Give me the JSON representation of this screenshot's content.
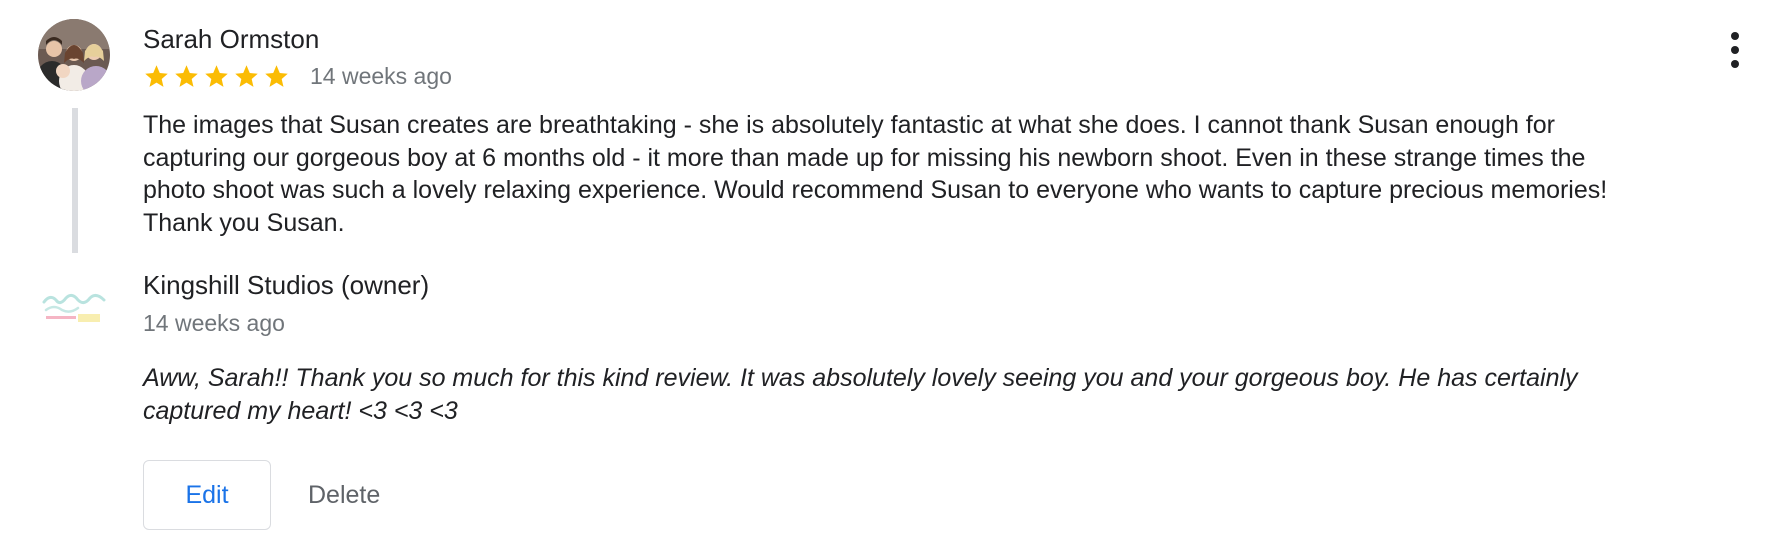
{
  "review": {
    "reviewer_name": "Sarah Ormston",
    "rating": 5,
    "max_rating": 5,
    "date": "14 weeks ago",
    "text": "The images that Susan creates are breathtaking - she is absolutely fantastic at what she does. I cannot thank Susan enough for capturing our gorgeous boy at 6 months old - it more than made up for missing his newborn shoot. Even in these strange times the photo shoot was such a lovely relaxing experience. Would recommend Susan to everyone who wants to capture precious memories! Thank you Susan.",
    "more_icon": "more-vert-icon"
  },
  "reply": {
    "owner_name": "Kingshill Studios (owner)",
    "date": "14 weeks ago",
    "text": "Aww, Sarah!! Thank you so much for this kind review. It was absolutely lovely seeing you and your gorgeous boy. He has certainly captured my heart! <3 <3 <3"
  },
  "actions": {
    "edit_label": "Edit",
    "delete_label": "Delete"
  },
  "colors": {
    "star": "#fbbc04",
    "link_blue": "#1a73e8",
    "secondary_text": "#70757a",
    "thread_line": "#dadce0"
  }
}
